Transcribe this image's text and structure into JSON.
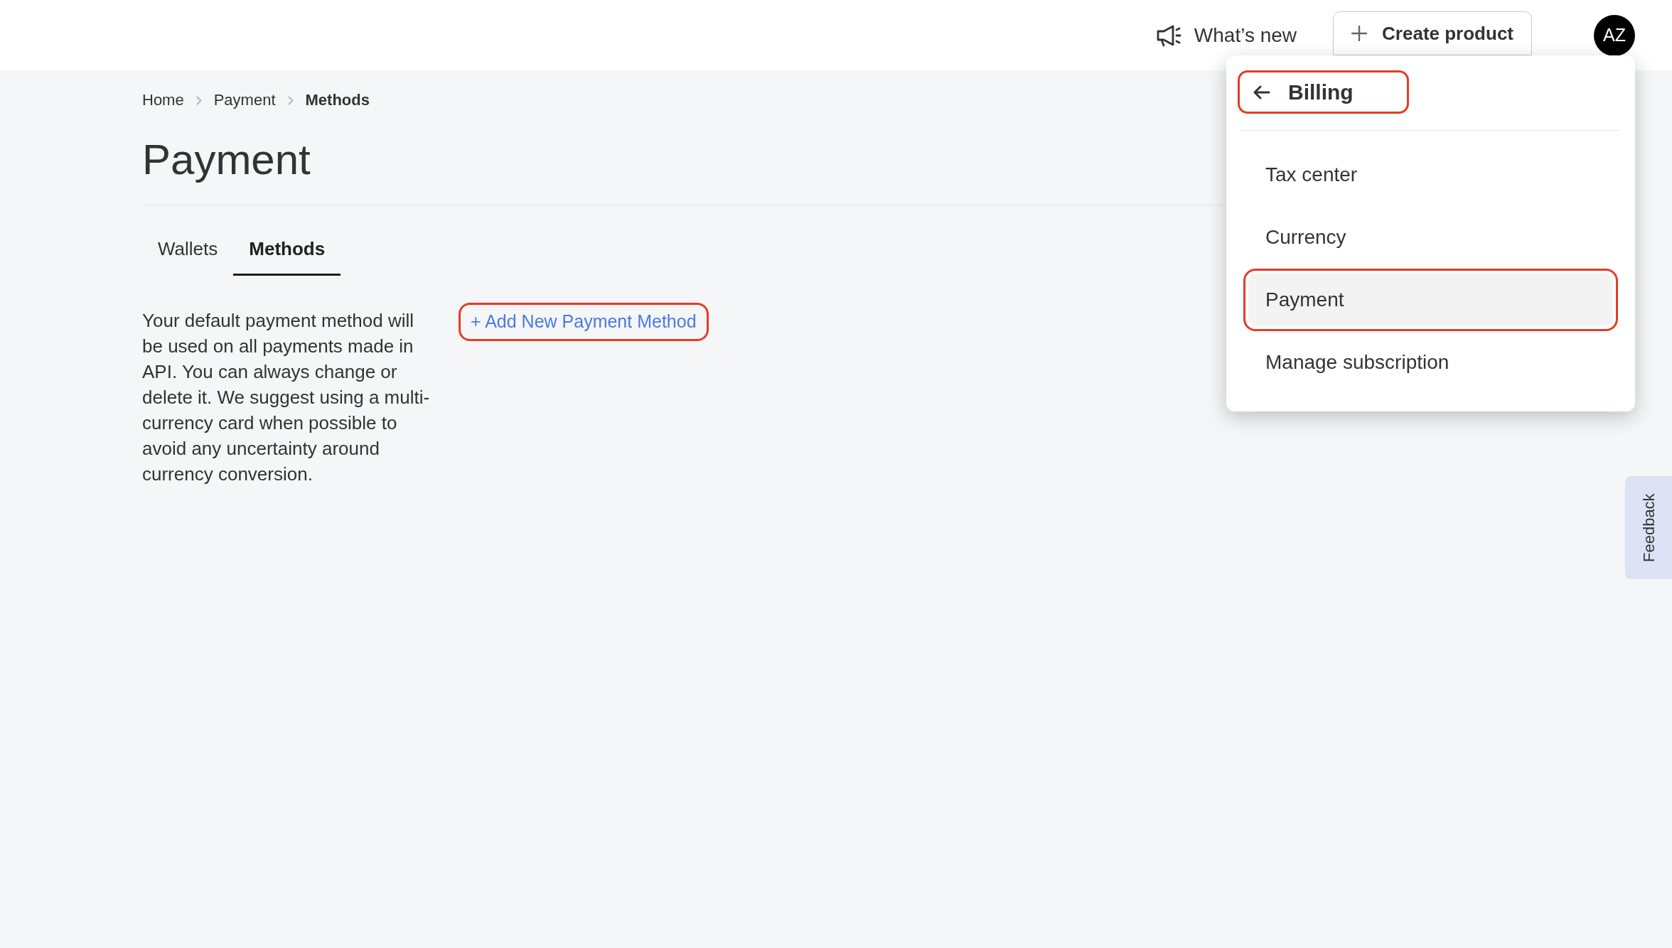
{
  "top_bar": {
    "whats_new": "What’s new",
    "create_button": "Create product",
    "avatar": "AZ"
  },
  "breadcrumb": [
    {
      "label": "Home",
      "current": false
    },
    {
      "label": "Payment",
      "current": false
    },
    {
      "label": "Methods",
      "current": true
    }
  ],
  "page_title": "Payment",
  "tabs": [
    {
      "label": "Wallets",
      "selected": false
    },
    {
      "label": "Methods",
      "selected": true
    }
  ],
  "description": "Your default payment method will be used on all payments made in API. You can always change or delete it. We suggest using a multi-currency card when possible to avoid any uncertainty around currency conversion.",
  "add_link": {
    "label": "+ Add New Payment Method",
    "highlighted": true
  },
  "menu": {
    "header": {
      "label": "Billing",
      "highlighted": true
    },
    "items": [
      {
        "label": "Tax center",
        "selected": false,
        "highlighted": false
      },
      {
        "label": "Currency",
        "selected": false,
        "highlighted": false
      },
      {
        "label": "Payment",
        "selected": true,
        "highlighted": true
      },
      {
        "label": "Manage subscription",
        "selected": false,
        "highlighted": false
      }
    ]
  },
  "feedback_tab": "Feedback"
}
